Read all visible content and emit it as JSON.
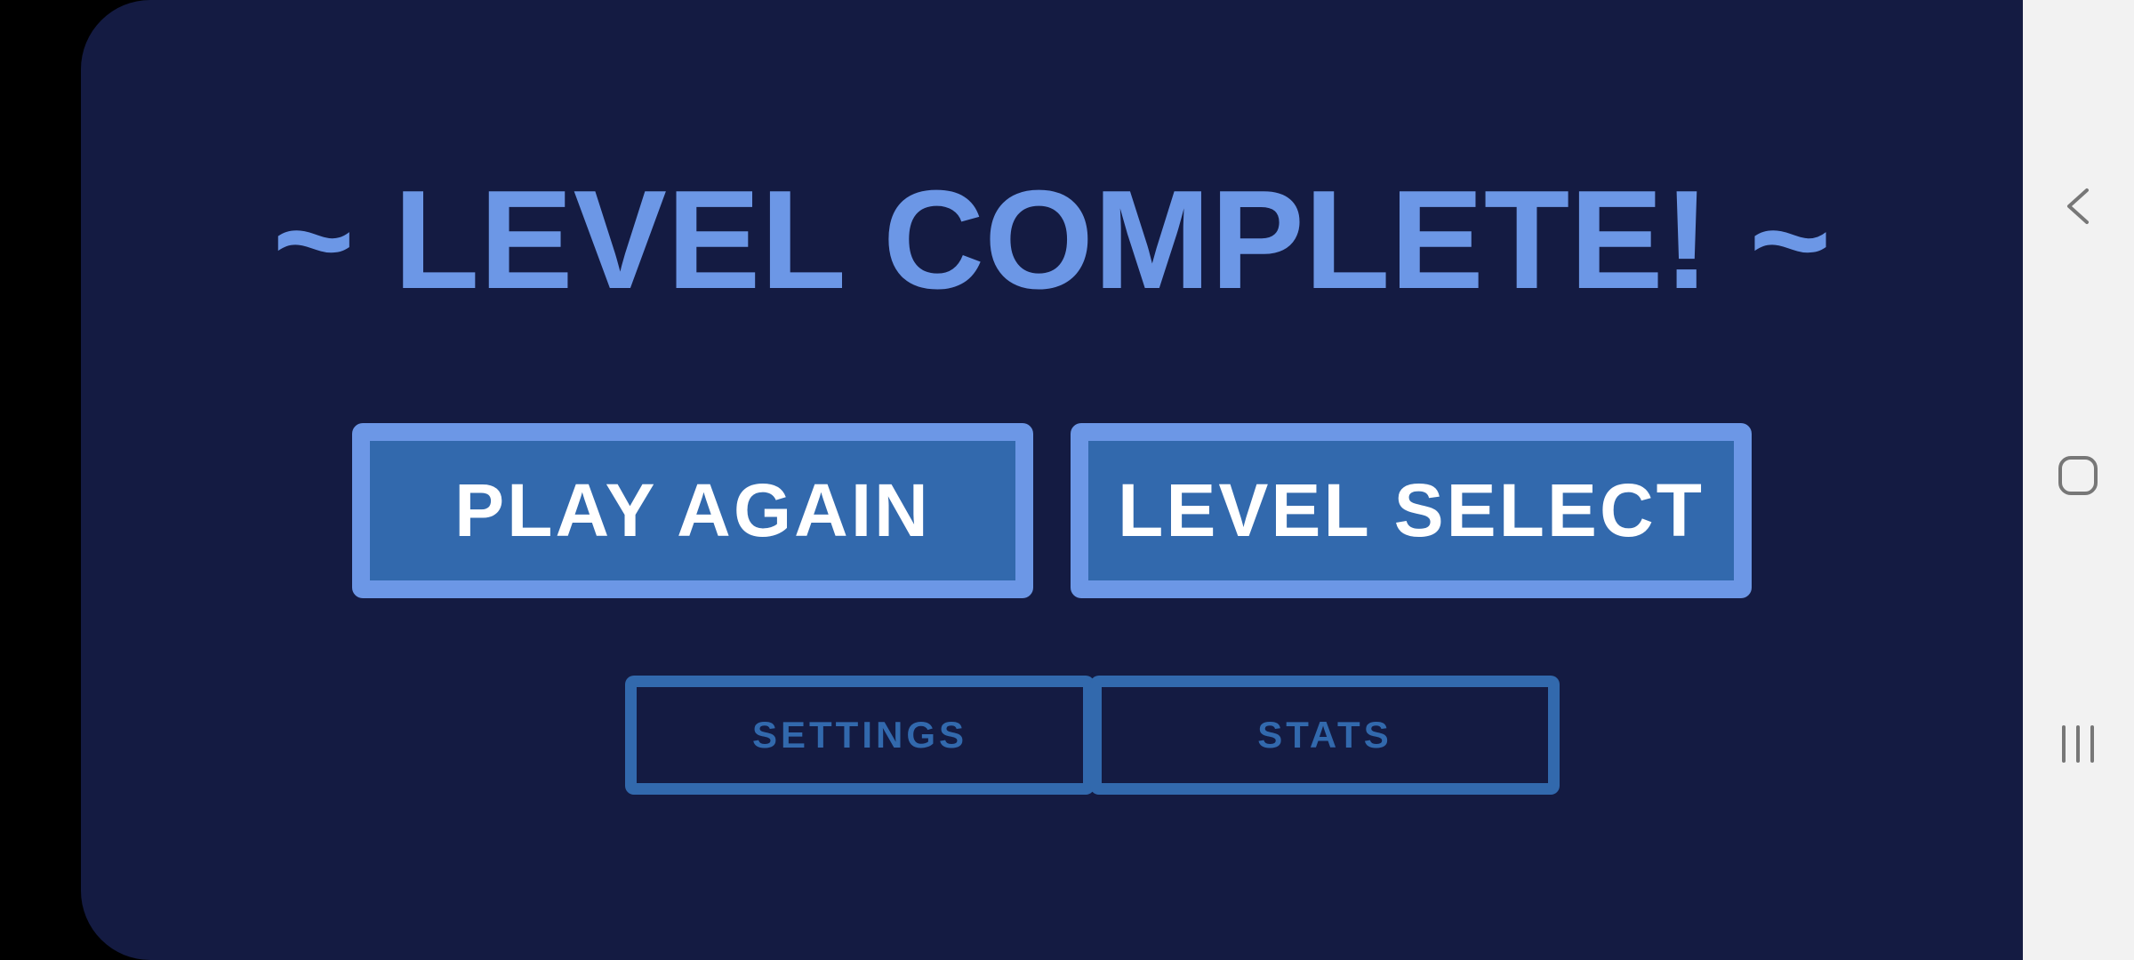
{
  "game": {
    "title": "~ LEVEL COMPLETE! ~",
    "buttons": {
      "play_again": "PLAY AGAIN",
      "level_select": "LEVEL SELECT",
      "settings": "SETTINGS",
      "stats": "STATS"
    },
    "colors": {
      "background": "#141b42",
      "accent_light": "#6c97e6",
      "accent_dark": "#3269ad",
      "button_text": "#ffffff"
    }
  },
  "navigation_bar": {
    "icons": [
      "back-icon",
      "home-icon",
      "recents-icon"
    ],
    "background": "#f2f2f2",
    "icon_color": "#777777"
  }
}
